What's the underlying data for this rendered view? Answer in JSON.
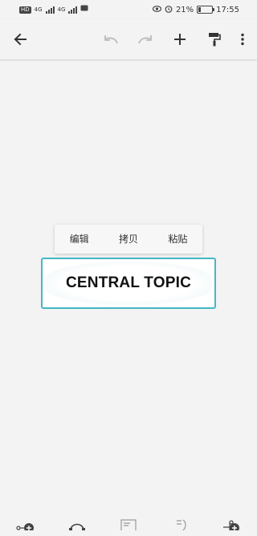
{
  "status_bar": {
    "left_badges": [
      "HD",
      "4G",
      "4G"
    ],
    "battery_percent": "21%",
    "time": "17:55",
    "battery_level": 0.21
  },
  "app_bar": {
    "icons": [
      "back-arrow-icon",
      "undo-icon",
      "redo-icon",
      "add-icon",
      "format-paint-icon",
      "more-vert-icon"
    ]
  },
  "context_menu": {
    "items": [
      "编辑",
      "拷贝",
      "粘贴"
    ]
  },
  "central_topic": {
    "label": "CENTRAL TOPIC",
    "border_color": "#45b6c6"
  },
  "bottom_toolbar": {
    "icons": [
      "add-subtopic-icon",
      "relationship-icon",
      "notes-icon",
      "boundary-icon",
      "add-topic-icon"
    ]
  }
}
